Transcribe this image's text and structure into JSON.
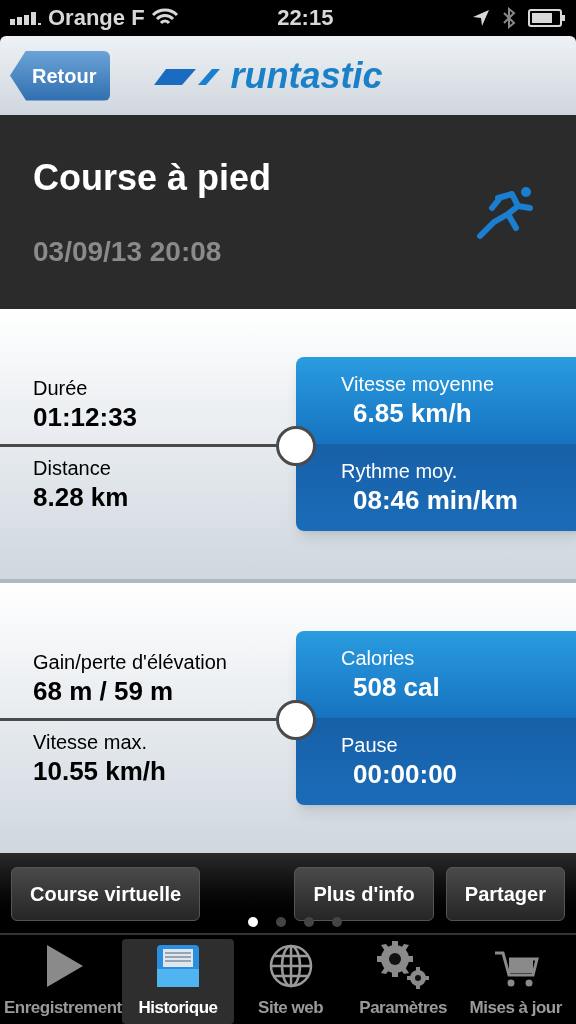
{
  "status_bar": {
    "carrier": "Orange F",
    "time": "22:15"
  },
  "nav": {
    "back": "Retour",
    "logo": "runtastic"
  },
  "header": {
    "title": "Course à pied",
    "datetime": "03/09/13 20:08"
  },
  "panels": [
    {
      "left": [
        {
          "label": "Durée",
          "value": "01:12:33"
        },
        {
          "label": "Distance",
          "value": "8.28 km"
        }
      ],
      "right": [
        {
          "label": "Vitesse moyenne",
          "value": "6.85 km/h"
        },
        {
          "label": "Rythme moy.",
          "value": "08:46 min/km"
        }
      ]
    },
    {
      "left": [
        {
          "label": "Gain/perte d'élévation",
          "value": "68 m / 59 m"
        },
        {
          "label": "Vitesse max.",
          "value": "10.55 km/h"
        }
      ],
      "right": [
        {
          "label": "Calories",
          "value": "508 cal"
        },
        {
          "label": "Pause",
          "value": "00:00:00"
        }
      ]
    }
  ],
  "actions": [
    "Course virtuelle",
    "Plus d'info",
    "Partager"
  ],
  "page_dots": [
    {
      "selected": true
    },
    {
      "selected": false
    },
    {
      "selected": false
    },
    {
      "selected": false
    }
  ],
  "tabs": [
    {
      "label": "Enregistrement",
      "kind": "play",
      "selected": false
    },
    {
      "label": "Historique",
      "kind": "history",
      "selected": true
    },
    {
      "label": "Site web",
      "kind": "globe",
      "selected": false
    },
    {
      "label": "Paramètres",
      "kind": "gears",
      "selected": false
    },
    {
      "label": "Mises à jour",
      "kind": "cart",
      "selected": false
    }
  ]
}
